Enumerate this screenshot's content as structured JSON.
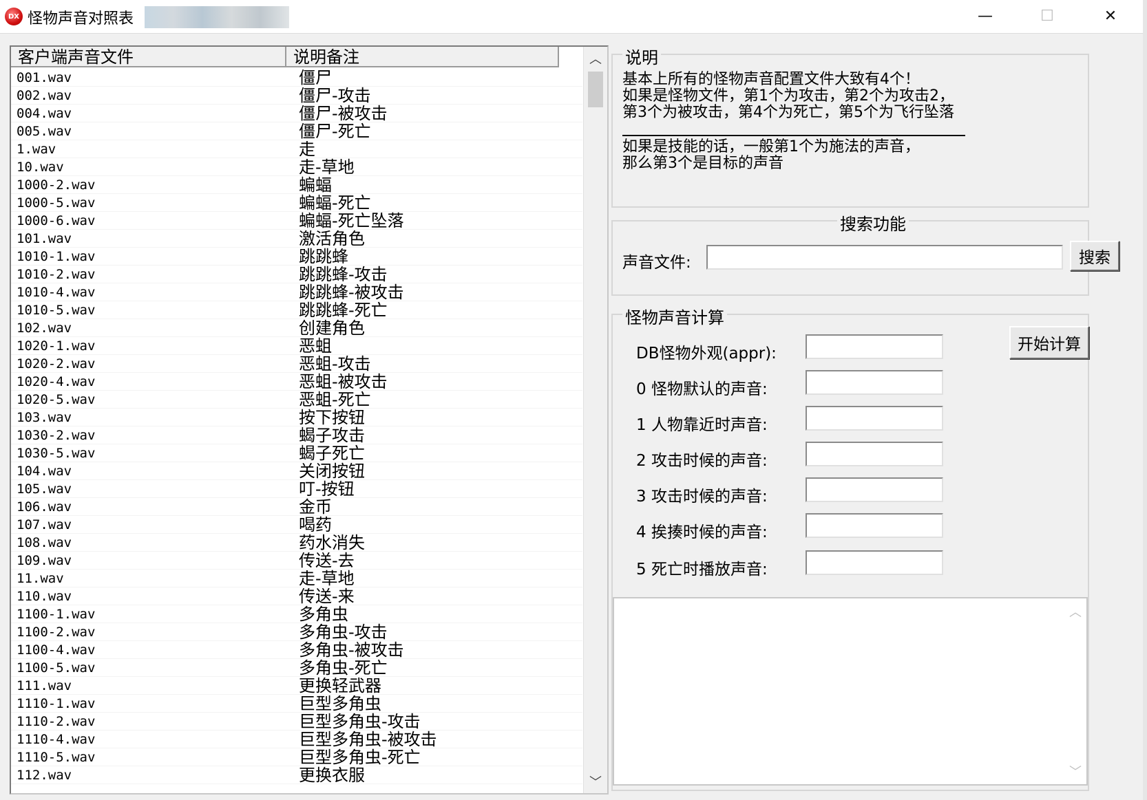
{
  "window": {
    "title": "怪物声音对照表",
    "icon_label": "DX",
    "minimize": "—",
    "maximize": "☐",
    "close": "✕"
  },
  "list": {
    "columns": [
      "客户端声音文件",
      "说明备注"
    ],
    "rows": [
      [
        "001.wav",
        "僵尸"
      ],
      [
        "002.wav",
        "僵尸-攻击"
      ],
      [
        "004.wav",
        "僵尸-被攻击"
      ],
      [
        "005.wav",
        "僵尸-死亡"
      ],
      [
        "1.wav",
        "走"
      ],
      [
        "10.wav",
        "走-草地"
      ],
      [
        "1000-2.wav",
        "蝙蝠"
      ],
      [
        "1000-5.wav",
        "蝙蝠-死亡"
      ],
      [
        "1000-6.wav",
        "蝙蝠-死亡坠落"
      ],
      [
        "101.wav",
        "激活角色"
      ],
      [
        "1010-1.wav",
        "跳跳蜂"
      ],
      [
        "1010-2.wav",
        "跳跳蜂-攻击"
      ],
      [
        "1010-4.wav",
        "跳跳蜂-被攻击"
      ],
      [
        "1010-5.wav",
        "跳跳蜂-死亡"
      ],
      [
        "102.wav",
        "创建角色"
      ],
      [
        "1020-1.wav",
        "恶蛆"
      ],
      [
        "1020-2.wav",
        "恶蛆-攻击"
      ],
      [
        "1020-4.wav",
        "恶蛆-被攻击"
      ],
      [
        "1020-5.wav",
        "恶蛆-死亡"
      ],
      [
        "103.wav",
        "按下按钮"
      ],
      [
        "1030-2.wav",
        "蝎子攻击"
      ],
      [
        "1030-5.wav",
        "蝎子死亡"
      ],
      [
        "104.wav",
        "关闭按钮"
      ],
      [
        "105.wav",
        "叮-按钮"
      ],
      [
        "106.wav",
        "金币"
      ],
      [
        "107.wav",
        "喝药"
      ],
      [
        "108.wav",
        "药水消失"
      ],
      [
        "109.wav",
        "传送-去"
      ],
      [
        "11.wav",
        "走-草地"
      ],
      [
        "110.wav",
        "传送-来"
      ],
      [
        "1100-1.wav",
        "多角虫"
      ],
      [
        "1100-2.wav",
        "多角虫-攻击"
      ],
      [
        "1100-4.wav",
        "多角虫-被攻击"
      ],
      [
        "1100-5.wav",
        "多角虫-死亡"
      ],
      [
        "111.wav",
        "更换轻武器"
      ],
      [
        "1110-1.wav",
        "巨型多角虫"
      ],
      [
        "1110-2.wav",
        "巨型多角虫-攻击"
      ],
      [
        "1110-4.wav",
        "巨型多角虫-被攻击"
      ],
      [
        "1110-5.wav",
        "巨型多角虫-死亡"
      ],
      [
        "112.wav",
        "更换衣服"
      ]
    ]
  },
  "description": {
    "legend": "说明",
    "lines": [
      "基本上所有的怪物声音配置文件大致有4个！",
      "如果是怪物文件，第1个为攻击，第2个为攻击2，",
      "第3个为被攻击，第4个为死亡，第5个为飞行坠落",
      "如果是技能的话，一般第1个为施法的声音，",
      "那么第3个是目标的声音"
    ]
  },
  "search": {
    "legend": "搜索功能",
    "label": "声音文件:",
    "value": "",
    "button": "搜索"
  },
  "calc": {
    "legend": "怪物声音计算",
    "button": "开始计算",
    "fields": [
      {
        "label": "DB怪物外观(appr):",
        "value": ""
      },
      {
        "label": "0 怪物默认的声音:",
        "value": ""
      },
      {
        "label": "1 人物靠近时声音:",
        "value": ""
      },
      {
        "label": "2 攻击时候的声音:",
        "value": ""
      },
      {
        "label": "3 攻击时候的声音:",
        "value": ""
      },
      {
        "label": "4 挨揍时候的声音:",
        "value": ""
      },
      {
        "label": "5 死亡时播放声音:",
        "value": ""
      }
    ],
    "output": ""
  }
}
